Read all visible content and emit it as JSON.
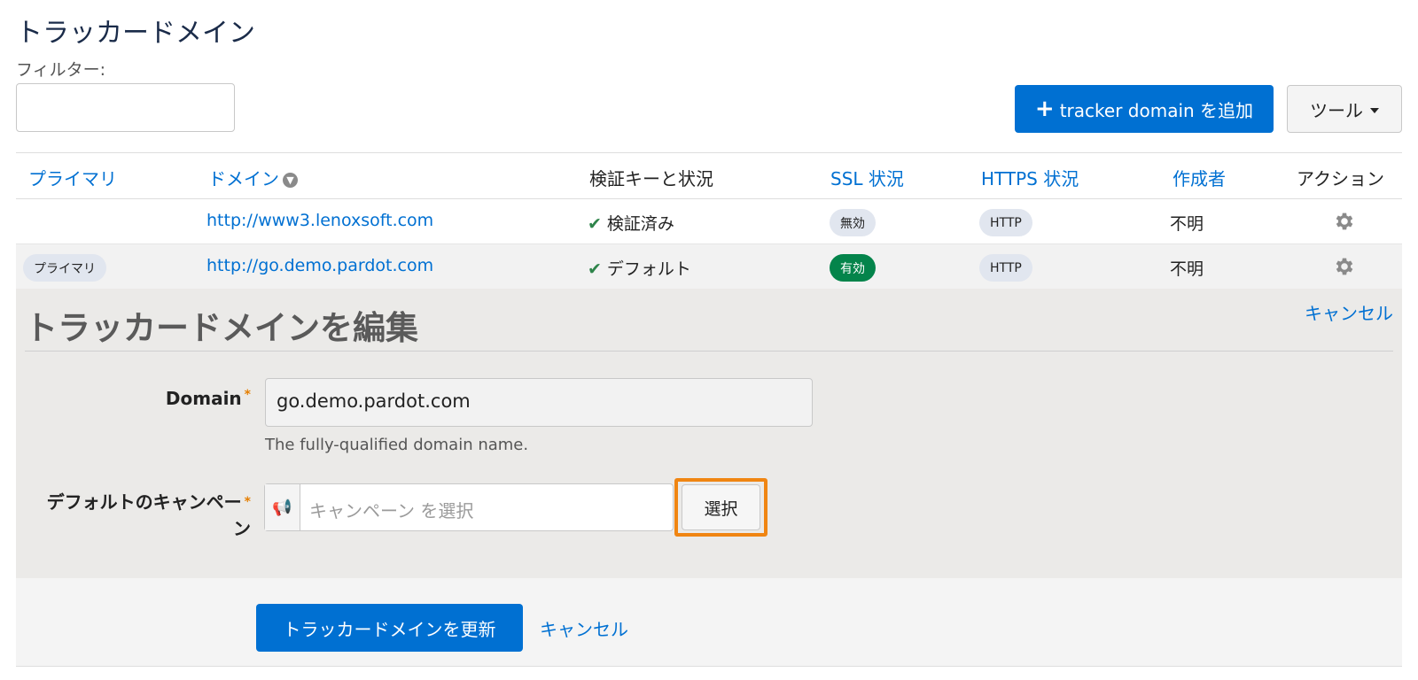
{
  "page": {
    "title": "トラッカードメイン",
    "filter_label": "フィルター:",
    "filter_value": ""
  },
  "toolbar": {
    "add_plus": "+",
    "add_label": "tracker domain を追加",
    "tools_label": "ツール"
  },
  "table": {
    "headers": {
      "primary": "プライマリ",
      "domain": "ドメイン",
      "verify": "検証キーと状況",
      "ssl": "SSL 状況",
      "https": "HTTPS 状況",
      "creator": "作成者",
      "action": "アクション"
    },
    "rows": [
      {
        "primary": "",
        "domain": "http://www3.lenoxsoft.com",
        "verify": "検証済み",
        "ssl": "無効",
        "https": "HTTP",
        "creator": "不明"
      },
      {
        "primary": "プライマリ",
        "domain": "http://go.demo.pardot.com",
        "verify": "デフォルト",
        "ssl": "有効",
        "https": "HTTP",
        "creator": "不明"
      }
    ]
  },
  "edit": {
    "title": "トラッカードメインを編集",
    "cancel_top": "キャンセル",
    "domain_label": "Domain",
    "domain_value": "go.demo.pardot.com",
    "domain_help": "The fully-qualified domain name.",
    "campaign_label_1": "デフォルトのキャンペー",
    "campaign_label_2": "ン",
    "required_mark": "*",
    "campaign_placeholder": "キャンペーン を選択",
    "select_label": "選択",
    "update_label": "トラッカードメインを更新",
    "cancel_bottom": "キャンセル"
  },
  "colors": {
    "accent": "#0070d2",
    "success": "#04844b",
    "highlight": "#f08512"
  }
}
